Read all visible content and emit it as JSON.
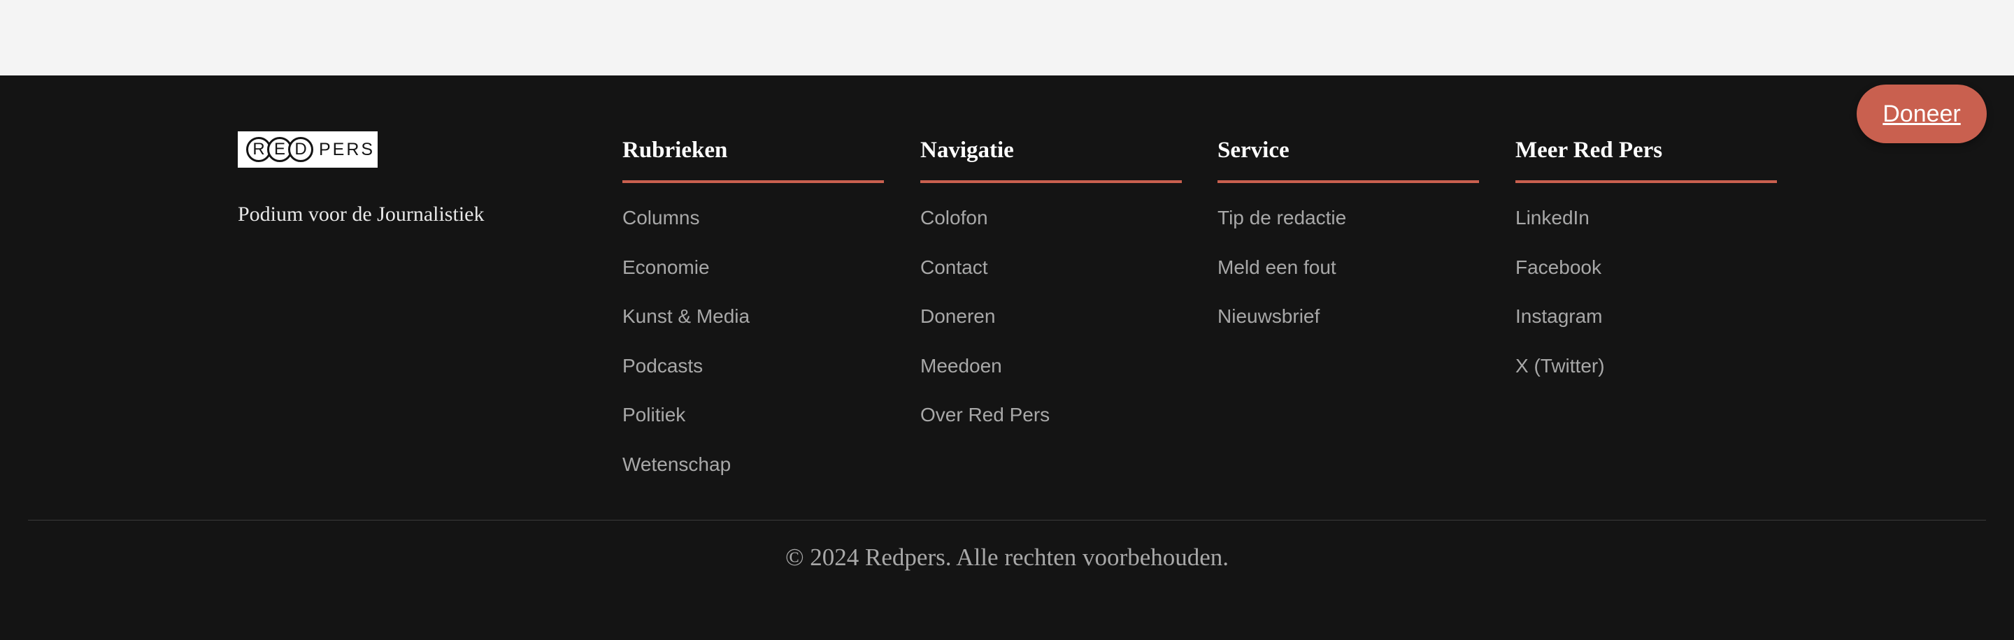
{
  "brand": {
    "logo_letters": [
      "R",
      "E",
      "D"
    ],
    "logo_suffix": "PERS",
    "tagline": "Podium voor de Journalistiek"
  },
  "columns": [
    {
      "title": "Rubrieken",
      "items": [
        "Columns",
        "Economie",
        "Kunst & Media",
        "Podcasts",
        "Politiek",
        "Wetenschap"
      ]
    },
    {
      "title": "Navigatie",
      "items": [
        "Colofon",
        "Contact",
        "Doneren",
        "Meedoen",
        "Over Red Pers"
      ]
    },
    {
      "title": "Service",
      "items": [
        "Tip de redactie",
        "Meld een fout",
        "Nieuwsbrief"
      ]
    },
    {
      "title": "Meer Red Pers",
      "items": [
        "LinkedIn",
        "Facebook",
        "Instagram",
        "X (Twitter)"
      ]
    }
  ],
  "donate_button": "Doneer",
  "copyright": "© 2024 Redpers. Alle rechten voorbehouden.",
  "colors": {
    "accent": "#c9604f",
    "background": "#141414",
    "top_strip": "#f4f4f4"
  }
}
